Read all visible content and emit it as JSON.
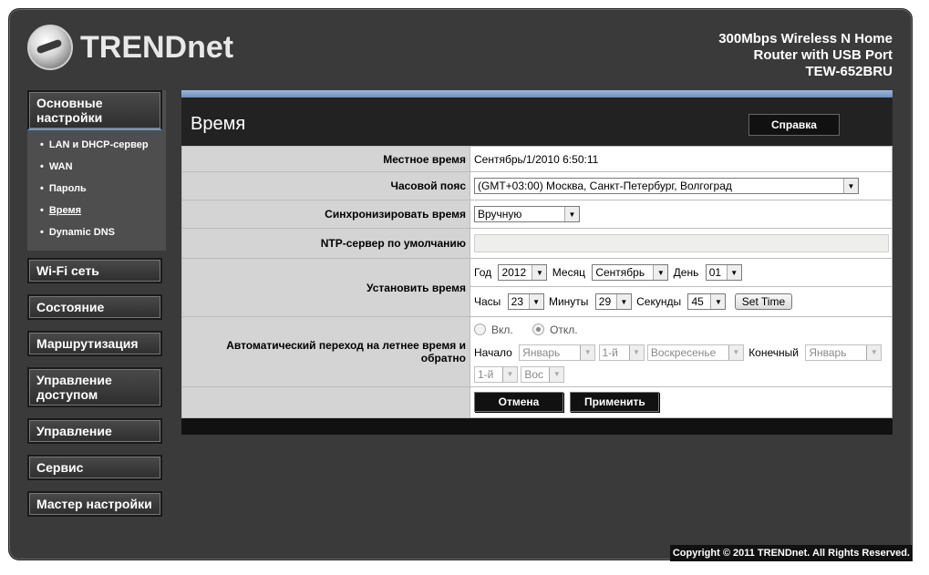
{
  "brand": {
    "name": "TRENDnet"
  },
  "product": {
    "line1": "300Mbps Wireless N Home",
    "line2": "Router with USB Port",
    "model": "TEW-652BRU"
  },
  "sidebar": {
    "basic": "Основные настройки",
    "sub_items": [
      "LAN и DHCP-сервер",
      "WAN",
      "Пароль",
      "Время",
      "Dynamic DNS"
    ],
    "items": [
      "Wi-Fi сеть",
      "Состояние",
      "Маршрутизация",
      "Управление доступом",
      "Управление",
      "Сервис",
      "Мастер настройки"
    ]
  },
  "page": {
    "title": "Время",
    "help": "Справка"
  },
  "form": {
    "local_time_label": "Местное время",
    "local_time_value": "Сентябрь/1/2010 6:50:11",
    "timezone_label": "Часовой пояс",
    "timezone_value": "(GMT+03:00) Москва, Санкт-Петербург, Волгоград",
    "sync_label": "Синхронизировать время",
    "sync_value": "Вручную",
    "ntp_label": "NTP-сервер по умолчанию",
    "set_time_label": "Установить время",
    "year_label": "Год",
    "year_value": "2012",
    "month_label": "Месяц",
    "month_value": "Сентябрь",
    "day_label": "День",
    "day_value": "01",
    "hours_label": "Часы",
    "hours_value": "23",
    "minutes_label": "Минуты",
    "minutes_value": "29",
    "seconds_label": "Секунды",
    "seconds_value": "45",
    "set_time_button": "Set Time",
    "dst_label": "Автоматический переход на летнее время и обратно",
    "dst_on": "Вкл.",
    "dst_off": "Откл.",
    "start_label": "Начало",
    "end_label": "Конечный",
    "start_month": "Январь",
    "start_week": "1-й",
    "start_day": "Воскресенье",
    "end_month": "Январь",
    "end_week": "1-й",
    "end_day": "Вос",
    "cancel": "Отмена",
    "apply": "Применить"
  },
  "footer": {
    "copyright": "Copyright © 2011 TRENDnet. All Rights Reserved."
  }
}
